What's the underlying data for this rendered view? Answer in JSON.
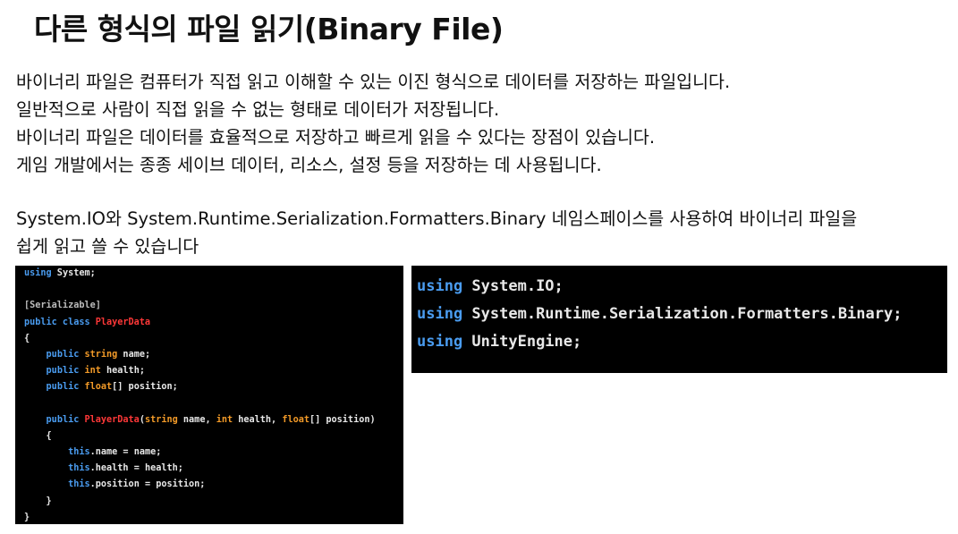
{
  "title": "다른 형식의 파일 읽기(Binary File)",
  "description": {
    "lines": [
      "바이너리 파일은 컴퓨터가 직접 읽고 이해할 수 있는 이진 형식으로 데이터를 저장하는 파일입니다.",
      "일반적으로 사람이 직접 읽을 수 없는 형태로 데이터가 저장됩니다.",
      "바이너리 파일은 데이터를 효율적으로 저장하고 빠르게 읽을 수 있다는 장점이 있습니다.",
      "게임 개발에서는 종종 세이브 데이터, 리소스, 설정 등을 저장하는 데 사용됩니다."
    ]
  },
  "namespace_note": {
    "lines": [
      " System.IO와 System.Runtime.Serialization.Formatters.Binary 네임스페이스를 사용하여 바이너리 파일을",
      "쉽게 읽고 쓸 수 있습니다"
    ]
  },
  "code_class": {
    "lines": [
      [
        {
          "t": "using",
          "c": "kw"
        },
        {
          "t": " System;"
        }
      ],
      [],
      [
        {
          "t": "[Serializable]",
          "c": "at"
        }
      ],
      [
        {
          "t": "public class ",
          "c": "kw"
        },
        {
          "t": "PlayerData",
          "c": "cn"
        }
      ],
      [
        {
          "t": "{"
        }
      ],
      [
        {
          "t": "    "
        },
        {
          "t": "public ",
          "c": "kw"
        },
        {
          "t": "string",
          "c": "ty"
        },
        {
          "t": " name;"
        }
      ],
      [
        {
          "t": "    "
        },
        {
          "t": "public ",
          "c": "kw"
        },
        {
          "t": "int",
          "c": "ty"
        },
        {
          "t": " health;"
        }
      ],
      [
        {
          "t": "    "
        },
        {
          "t": "public ",
          "c": "kw"
        },
        {
          "t": "float",
          "c": "ty"
        },
        {
          "t": "[] position;"
        }
      ],
      [],
      [
        {
          "t": "    "
        },
        {
          "t": "public ",
          "c": "kw"
        },
        {
          "t": "PlayerData",
          "c": "cn"
        },
        {
          "t": "("
        },
        {
          "t": "string",
          "c": "ty"
        },
        {
          "t": " name, "
        },
        {
          "t": "int",
          "c": "ty"
        },
        {
          "t": " health, "
        },
        {
          "t": "float",
          "c": "ty"
        },
        {
          "t": "[] position)"
        }
      ],
      [
        {
          "t": "    {"
        }
      ],
      [
        {
          "t": "        "
        },
        {
          "t": "this",
          "c": "kw"
        },
        {
          "t": ".name = name;"
        }
      ],
      [
        {
          "t": "        "
        },
        {
          "t": "this",
          "c": "kw"
        },
        {
          "t": ".health = health;"
        }
      ],
      [
        {
          "t": "        "
        },
        {
          "t": "this",
          "c": "kw"
        },
        {
          "t": ".position = position;"
        }
      ],
      [
        {
          "t": "    }"
        }
      ],
      [
        {
          "t": "}"
        }
      ]
    ]
  },
  "code_using": {
    "lines": [
      [
        {
          "t": "using",
          "c": "kw"
        },
        {
          "t": " System.IO;"
        }
      ],
      [
        {
          "t": "using",
          "c": "kw"
        },
        {
          "t": " System.Runtime.Serialization.Formatters.Binary;"
        }
      ],
      [
        {
          "t": "using",
          "c": "kw"
        },
        {
          "t": " UnityEngine;"
        }
      ]
    ]
  },
  "colors": {
    "keyword": "#4a9cf0",
    "type": "#f29a28",
    "class_name": "#ff3838",
    "attribute": "#bdbdbd",
    "code_background": "#000000"
  }
}
